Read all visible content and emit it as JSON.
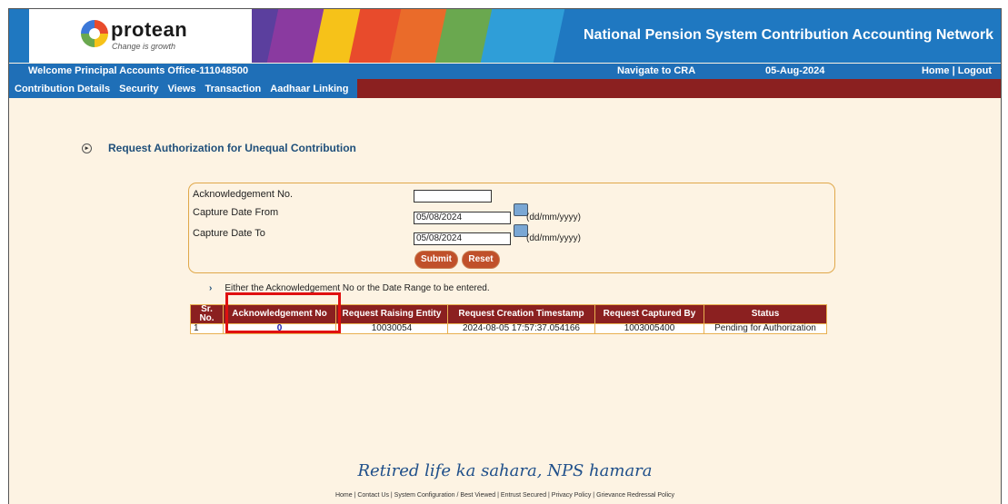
{
  "header": {
    "logo_text": "protean",
    "logo_tagline": "Change is growth",
    "site_title": "National Pension System Contribution Accounting Network"
  },
  "infobar": {
    "welcome": "Welcome Principal Accounts Office-111048500",
    "navigate": "Navigate to CRA",
    "date": "05-Aug-2024",
    "home_logout": "Home | Logout"
  },
  "nav": {
    "items": [
      "Contribution Details",
      "Security",
      "Views",
      "Transaction",
      "Aadhaar Linking"
    ]
  },
  "page": {
    "title": "Request Authorization for Unequal Contribution"
  },
  "form": {
    "ack_label": "Acknowledgement No.",
    "ack_value": "",
    "from_label": "Capture Date From",
    "from_value": "05/08/2024",
    "to_label": "Capture Date To",
    "to_value": "05/08/2024",
    "date_format": "(dd/mm/yyyy)",
    "submit": "Submit",
    "reset": "Reset"
  },
  "note": "Either the Acknowledgement No or the Date Range to be entered.",
  "table": {
    "headers": [
      "Sr. No.",
      "Acknowledgement No",
      "Request Raising Entity",
      "Request Creation Timestamp",
      "Request Captured By",
      "Status"
    ],
    "rows": [
      [
        "1",
        "0",
        "10030054",
        "2024-08-05 17:57:37.054166",
        "1003005400",
        "Pending for Authorization"
      ]
    ]
  },
  "slogan": "Retired life ka sahara, NPS hamara",
  "footer": "Home | Contact Us | System Configuration / Best Viewed | Entrust Secured | Privacy Policy | Grievance Redressal Policy",
  "colors": {
    "header_blue": "#1f78c1",
    "nav_maroon": "#8b2020",
    "button_orange": "#c0502a",
    "page_bg": "#fdf3e3",
    "highlight_red": "#e01010"
  }
}
